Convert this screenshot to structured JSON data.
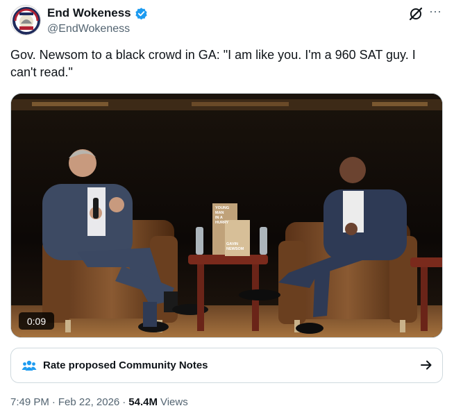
{
  "author": {
    "display_name": "End Wokeness",
    "handle": "@EndWokeness",
    "verified": true,
    "avatar_icon": "profile-badge-icon",
    "verified_color": "#1d9bf0"
  },
  "actions": {
    "grok_icon": "grok-icon",
    "more_label": "···"
  },
  "tweet": {
    "text": "Gov. Newsom to a black crowd in GA: \"I am like you. I'm a 960 SAT guy. I can't read.\""
  },
  "media": {
    "type": "video",
    "duration": "0:09",
    "book_cover_lines": [
      "YOUNG",
      "MAN",
      "IN A",
      "HURRY",
      "GAVIN",
      "NEWSOM"
    ]
  },
  "community_notes": {
    "icon": "community-notes-icon",
    "label": "Rate proposed Community Notes",
    "arrow_icon": "arrow-right-icon"
  },
  "meta": {
    "time": "7:49 PM",
    "separator": "·",
    "date": "Feb 22, 2026",
    "views_count": "54.4M",
    "views_label": "Views"
  },
  "colors": {
    "text": "#0f1419",
    "secondary": "#536471",
    "border": "#cfd9de"
  }
}
